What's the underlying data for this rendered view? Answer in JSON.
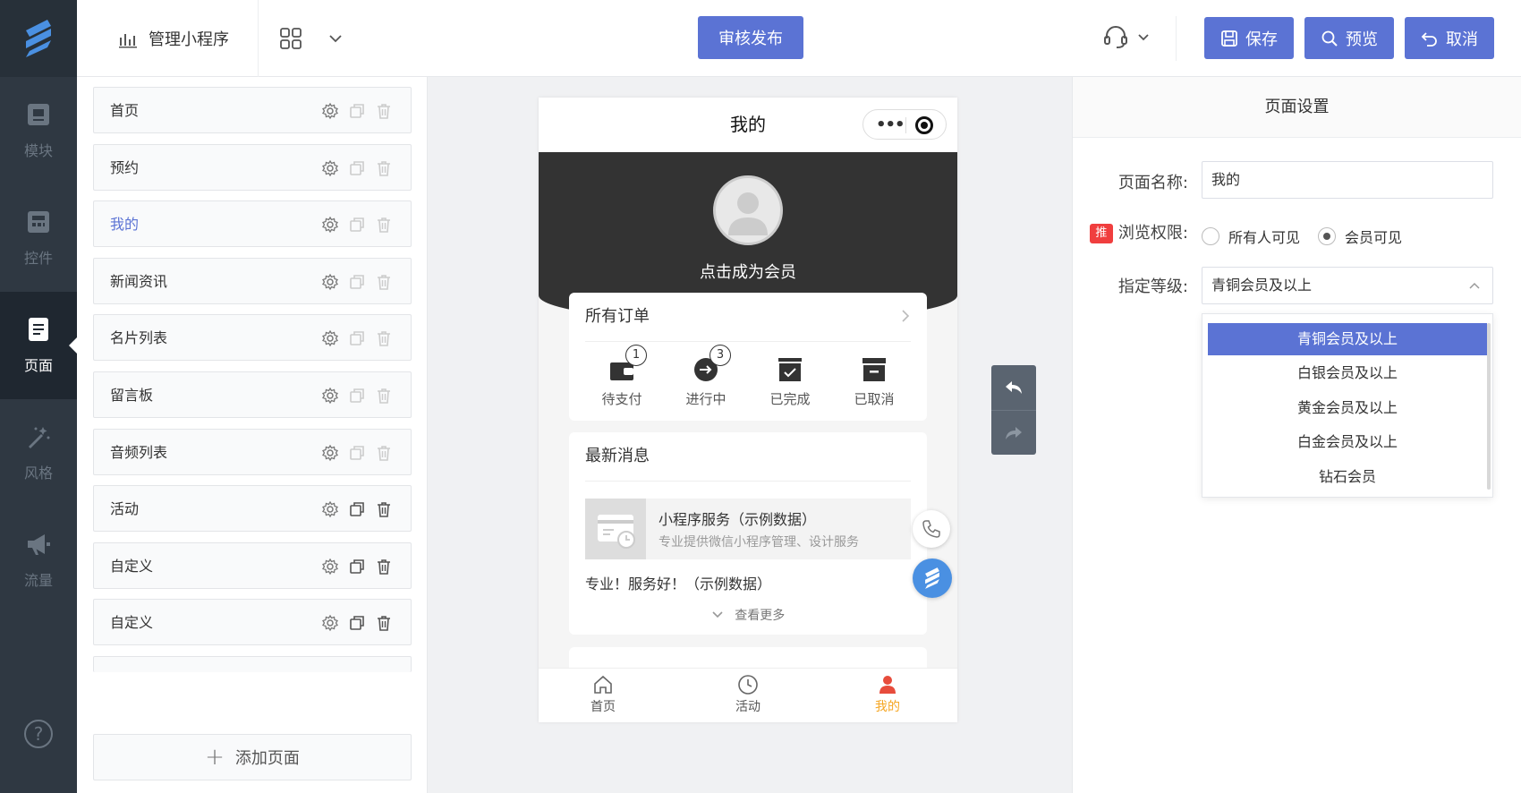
{
  "rail": {
    "items": [
      {
        "label": "模块",
        "icon": "module-icon"
      },
      {
        "label": "控件",
        "icon": "widget-icon"
      },
      {
        "label": "页面",
        "icon": "page-icon"
      },
      {
        "label": "风格",
        "icon": "magic-wand-icon"
      },
      {
        "label": "流量",
        "icon": "megaphone-icon"
      }
    ],
    "active_index": 2,
    "help_glyph": "?"
  },
  "topbar": {
    "app_label": "管理小程序",
    "publish_label": "审核发布",
    "save_label": "保存",
    "preview_label": "预览",
    "cancel_label": "取消"
  },
  "pages": {
    "items": [
      "首页",
      "预约",
      "我的",
      "新闻资讯",
      "名片列表",
      "留言板",
      "音频列表",
      "活动",
      "自定义",
      "自定义"
    ],
    "active_index": 2,
    "add_label": "添加页面"
  },
  "phone": {
    "title": "我的",
    "capsule_dots": "•••",
    "join_label": "点击成为会员",
    "orders": {
      "title": "所有订单",
      "items": [
        {
          "label": "待支付",
          "badge": "1"
        },
        {
          "label": "进行中",
          "badge": "3"
        },
        {
          "label": "已完成",
          "badge": ""
        },
        {
          "label": "已取消",
          "badge": ""
        }
      ]
    },
    "news": {
      "title": "最新消息",
      "item_title": "小程序服务（示例数据）",
      "item_desc": "专业提供微信小程序管理、设计服务",
      "text": "专业！服务好！（示例数据）",
      "more_label": "查看更多"
    },
    "tabs": [
      {
        "label": "首页",
        "icon": "home-icon"
      },
      {
        "label": "活动",
        "icon": "clock-icon"
      },
      {
        "label": "我的",
        "icon": "user-icon"
      }
    ],
    "active_tab": 2
  },
  "settings": {
    "header": "页面设置",
    "name_label": "页面名称:",
    "name_value": "我的",
    "access_tag": "推",
    "access_label": "浏览权限:",
    "access_options": [
      "所有人可见",
      "会员可见"
    ],
    "access_selected": 1,
    "level_label": "指定等级:",
    "level_value": "青铜会员及以上",
    "level_options": [
      "青铜会员及以上",
      "白银会员及以上",
      "黄金会员及以上",
      "白金会员及以上",
      "钻石会员"
    ],
    "level_selected": 0
  },
  "colors": {
    "accent": "#5b73d4",
    "rail_bg": "#2f3842",
    "hero_bg": "#333333",
    "tab_active": "#f5a623"
  }
}
